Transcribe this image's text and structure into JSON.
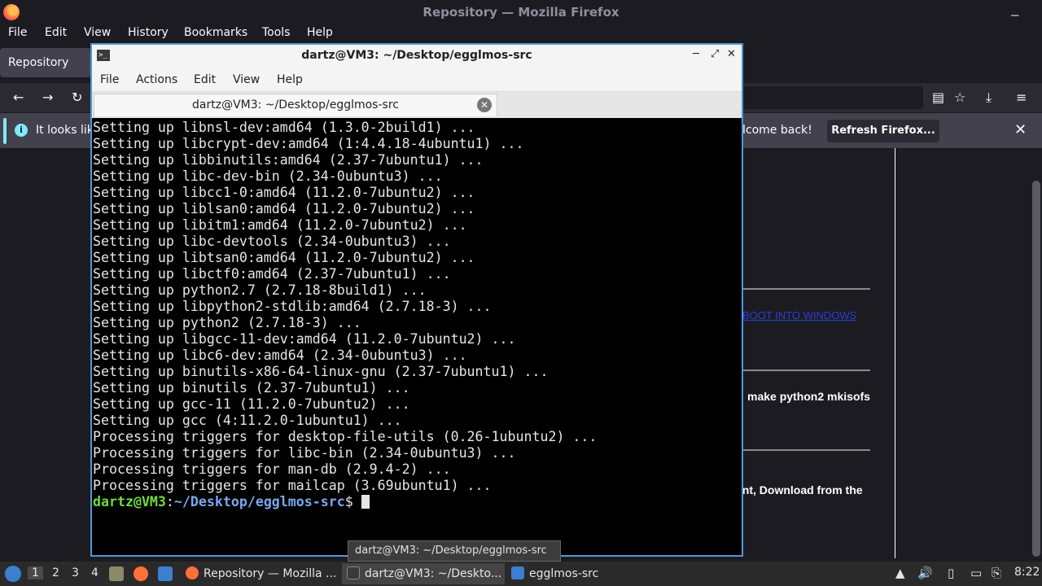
{
  "firefox": {
    "title": "Repository — Mozilla Firefox",
    "menu": [
      "File",
      "Edit",
      "View",
      "History",
      "Bookmarks",
      "Tools",
      "Help"
    ],
    "tab_label": "Repository",
    "notice_left": "It looks lik",
    "notice_right": "lcome back!",
    "refresh_button": "Refresh Firefox...",
    "page": {
      "link_text": "BOOT INTO WINDOWS",
      "line1": "make python2 mkisofs",
      "line2": "ent, Download from the"
    }
  },
  "terminal": {
    "title": "dartz@VM3: ~/Desktop/egglmos-src",
    "menu": [
      "File",
      "Actions",
      "Edit",
      "View",
      "Help"
    ],
    "tab_label": "dartz@VM3: ~/Desktop/egglmos-src",
    "lines": [
      "Setting up libnsl-dev:amd64 (1.3.0-2build1) ...",
      "Setting up libcrypt-dev:amd64 (1:4.4.18-4ubuntu1) ...",
      "Setting up libbinutils:amd64 (2.37-7ubuntu1) ...",
      "Setting up libc-dev-bin (2.34-0ubuntu3) ...",
      "Setting up libcc1-0:amd64 (11.2.0-7ubuntu2) ...",
      "Setting up liblsan0:amd64 (11.2.0-7ubuntu2) ...",
      "Setting up libitm1:amd64 (11.2.0-7ubuntu2) ...",
      "Setting up libc-devtools (2.34-0ubuntu3) ...",
      "Setting up libtsan0:amd64 (11.2.0-7ubuntu2) ...",
      "Setting up libctf0:amd64 (2.37-7ubuntu1) ...",
      "Setting up python2.7 (2.7.18-8build1) ...",
      "Setting up libpython2-stdlib:amd64 (2.7.18-3) ...",
      "Setting up python2 (2.7.18-3) ...",
      "Setting up libgcc-11-dev:amd64 (11.2.0-7ubuntu2) ...",
      "Setting up libc6-dev:amd64 (2.34-0ubuntu3) ...",
      "Setting up binutils-x86-64-linux-gnu (2.37-7ubuntu1) ...",
      "Setting up binutils (2.37-7ubuntu1) ...",
      "Setting up gcc-11 (11.2.0-7ubuntu2) ...",
      "Setting up gcc (4:11.2.0-1ubuntu1) ...",
      "Processing triggers for desktop-file-utils (0.26-1ubuntu2) ...",
      "Processing triggers for libc-bin (2.34-0ubuntu3) ...",
      "Processing triggers for man-db (2.9.4-2) ...",
      "Processing triggers for mailcap (3.69ubuntu1) ..."
    ],
    "prompt_user": "dartz@VM3",
    "prompt_sep": ":",
    "prompt_path": "~/Desktop/egglmos-src",
    "prompt_symbol": "$ "
  },
  "tooltip": "dartz@VM3: ~/Desktop/egglmos-src",
  "taskbar": {
    "workspaces": [
      "1",
      "2",
      "3",
      "4"
    ],
    "tasks": [
      "Repository — Mozilla ...",
      "dartz@VM3: ~/Deskto...",
      "egglmos-src"
    ],
    "clock": "8:22"
  }
}
